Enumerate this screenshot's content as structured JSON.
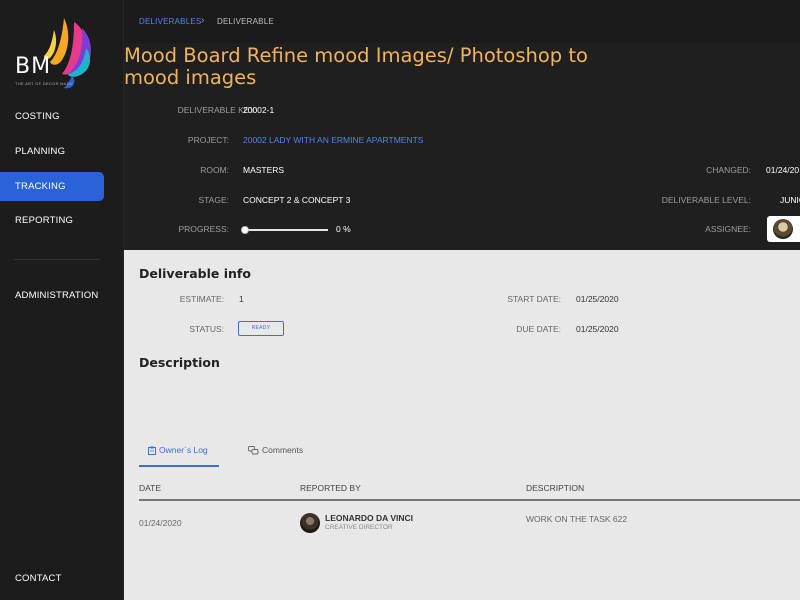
{
  "app": {
    "logo_text": "BM",
    "logo_tagline": "THE ART OF DECOR MADE"
  },
  "sidebar": {
    "items": [
      {
        "label": "COSTING"
      },
      {
        "label": "PLANNING"
      },
      {
        "label": "TRACKING",
        "active": true
      },
      {
        "label": "REPORTING"
      }
    ],
    "admin_label": "ADMINISTRATION",
    "support_label": "CONTACT SUPPORT"
  },
  "breadcrumb": {
    "parent": "DELIVERABLES",
    "separator": "›",
    "current": "DELIVERABLE"
  },
  "deliverable": {
    "title": "Mood Board Refine mood Images/ Photoshop to mood images",
    "key_label": "DELIVERABLE KEY:",
    "key": "20002-1",
    "project_label": "PROJECT:",
    "project": "20002 LADY WITH AN ERMINE APARTMENTS",
    "room_label": "ROOM:",
    "room": "MASTERS",
    "stage_label": "STAGE:",
    "stage": "CONCEPT 2 & CONCEPT 3",
    "progress_label": "PROGRESS:",
    "progress_value": 0,
    "progress_text": "0 %",
    "changed_label": "CHANGED:",
    "changed": "01/24/20",
    "level_label": "DELIVERABLE LEVEL:",
    "level": "JUNIOR",
    "assignee_label": "ASSIGNEE:"
  },
  "info": {
    "section_title": "Deliverable info",
    "estimate_label": "ESTIMATE:",
    "estimate": "1",
    "status_label": "STATUS:",
    "status": "READY",
    "start_label": "START DATE:",
    "start_date": "01/25/2020",
    "due_label": "DUE DATE:",
    "due_date": "01/25/2020"
  },
  "description": {
    "section_title": "Description"
  },
  "tabs": [
    {
      "label": "Owner`s Log",
      "active": true
    },
    {
      "label": "Comments"
    }
  ],
  "log_table": {
    "columns": [
      "DATE",
      "REPORTED BY",
      "DESCRIPTION"
    ],
    "rows": [
      {
        "date": "01/24/2020",
        "reporter": "LEONARDO DA VINCI",
        "role": "CREATIVE DIRECTOR",
        "description": "WORK ON THE TASK 622"
      }
    ]
  },
  "colors": {
    "accent": "#2962d9",
    "title": "#f2b35a",
    "link": "#4f86e8"
  }
}
